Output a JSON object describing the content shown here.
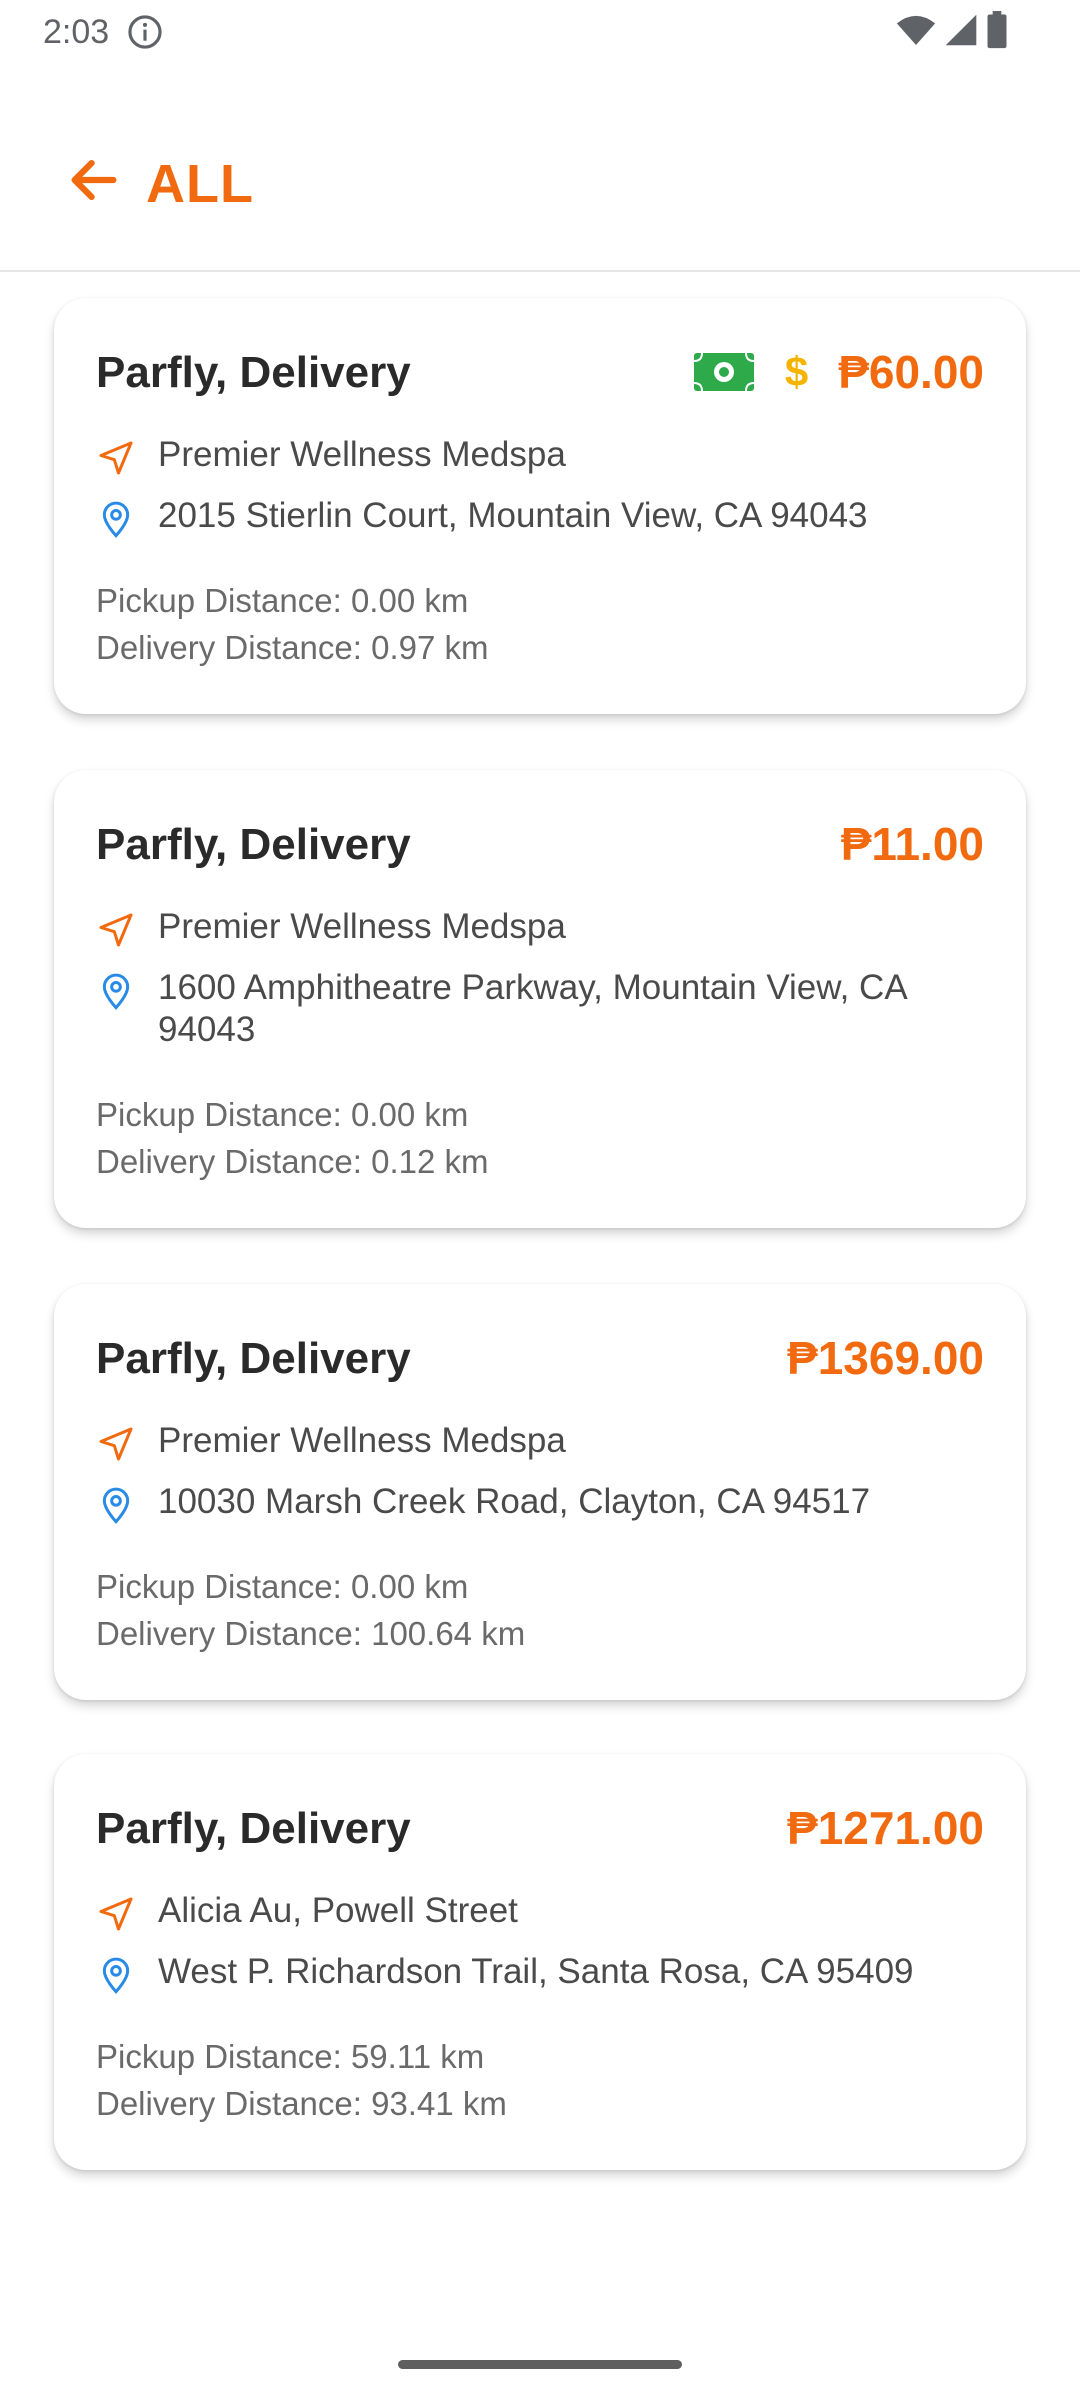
{
  "status_bar": {
    "time": "2:03"
  },
  "app_bar": {
    "title": "ALL"
  },
  "colors": {
    "accent": "#f26a0f",
    "cash_green": "#2eaa4a",
    "dollar_yellow": "#f6b400",
    "pickup_icon": "#f26a0f",
    "dropoff_icon": "#2a8be6"
  },
  "orders": [
    {
      "title": "Parfly, Delivery",
      "price": "₱60.00",
      "show_cash_icon": true,
      "dollar_symbol": "$",
      "pickup": "Premier Wellness Medspa",
      "dropoff": "2015 Stierlin Court, Mountain View, CA 94043",
      "pickup_distance": "Pickup Distance: 0.00 km",
      "delivery_distance": "Delivery Distance: 0.97 km"
    },
    {
      "title": "Parfly, Delivery",
      "price": "₱11.00",
      "pickup": "Premier Wellness Medspa",
      "dropoff": "1600 Amphitheatre Parkway, Mountain View, CA 94043",
      "pickup_distance": "Pickup Distance: 0.00 km",
      "delivery_distance": "Delivery Distance: 0.12 km"
    },
    {
      "title": "Parfly, Delivery",
      "price": "₱1369.00",
      "pickup": "Premier Wellness Medspa",
      "dropoff": "10030 Marsh Creek Road, Clayton, CA 94517",
      "pickup_distance": "Pickup Distance: 0.00 km",
      "delivery_distance": "Delivery Distance: 100.64 km"
    },
    {
      "title": "Parfly, Delivery",
      "price": "₱1271.00",
      "pickup": "Alicia Au, Powell Street",
      "dropoff": "West P. Richardson Trail, Santa Rosa, CA 95409",
      "pickup_distance": "Pickup Distance: 59.11 km",
      "delivery_distance": "Delivery Distance: 93.41 km"
    }
  ],
  "icons": {
    "back": "arrow-left-icon",
    "pickup": "navigation-arrow-icon",
    "dropoff": "location-pin-icon",
    "cash": "banknote-icon",
    "dollar": "dollar-sign-icon",
    "info": "info-circle-icon",
    "wifi": "wifi-icon",
    "signal": "cell-signal-icon",
    "battery": "battery-icon"
  }
}
